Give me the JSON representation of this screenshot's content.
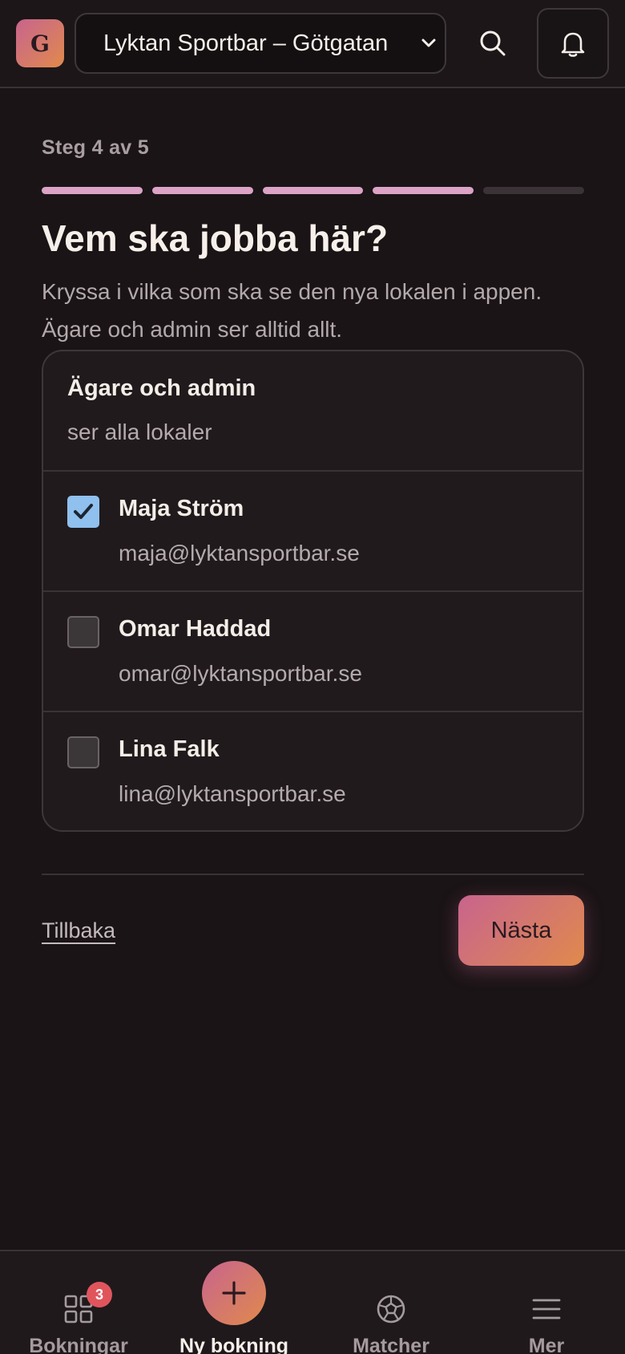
{
  "header": {
    "logo_letter": "G",
    "venue": "Lyktan Sportbar – Götgatan"
  },
  "wizard": {
    "step_label": "Steg 4 av 5",
    "current_step": 4,
    "total_steps": 5,
    "title": "Vem ska jobba här?",
    "subtitle": "Kryssa i vilka som ska se den nya lokalen i appen. Ägare och admin ser alltid allt."
  },
  "staff_card": {
    "heading": "Ägare och admin",
    "subheading": "ser alla lokaler",
    "people": [
      {
        "name": "Maja Ström",
        "email": "maja@lyktansportbar.se",
        "checked": true
      },
      {
        "name": "Omar Haddad",
        "email": "omar@lyktansportbar.se",
        "checked": false
      },
      {
        "name": "Lina Falk",
        "email": "lina@lyktansportbar.se",
        "checked": false
      }
    ]
  },
  "actions": {
    "back_label": "Tillbaka",
    "next_label": "Nästa"
  },
  "bottom_nav": {
    "bookings_label": "Bokningar",
    "bookings_badge": "3",
    "new_booking_label": "Ny bokning",
    "matches_label": "Matcher",
    "more_label": "Mer"
  },
  "colors": {
    "accent_start": "#c8648e",
    "accent_end": "#e08a4c",
    "progress_done": "#dca3c6",
    "checkbox_checked": "#8fc0ee",
    "badge": "#e0555c"
  }
}
